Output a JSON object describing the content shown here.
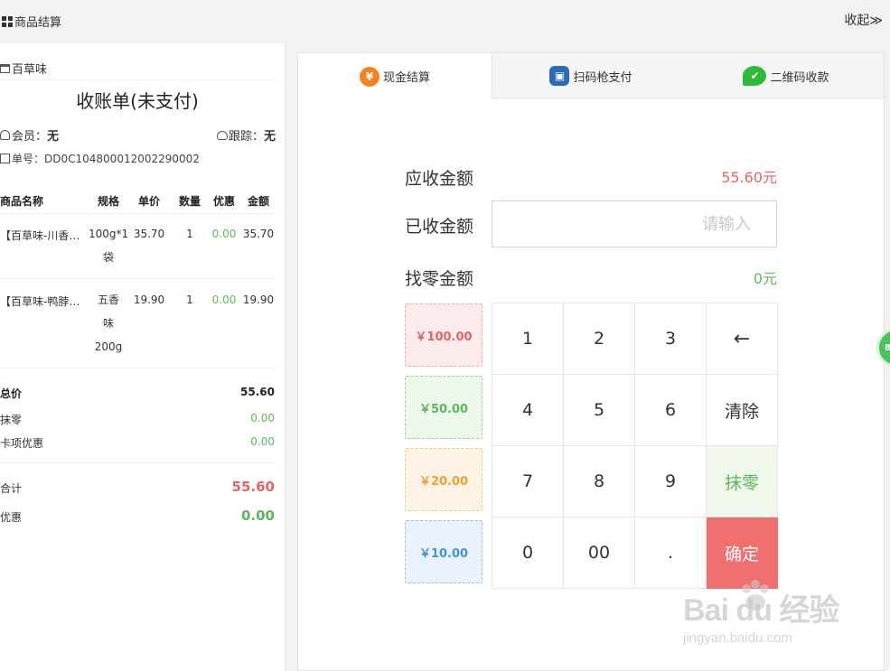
{
  "topbar": {
    "title": "商品结算",
    "collapse": "收起≫"
  },
  "receipt": {
    "shop": "百草味",
    "title": "收账单(未支付)",
    "member_label": "会员：",
    "member_value": "无",
    "track_label": "跟踪：",
    "track_value": "无",
    "order_label": "单号：",
    "order_no": "DD0C104800012002290002",
    "columns": [
      "商品名称",
      "规格",
      "单价",
      "数量",
      "优惠",
      "金额"
    ],
    "items": [
      {
        "name": "【百草味-川香…",
        "spec": [
          "100g*1",
          "袋"
        ],
        "price": "35.70",
        "qty": "1",
        "discount": "0.00",
        "amount": "35.70"
      },
      {
        "name": "【百草味-鸭脖…",
        "spec": [
          "五香",
          "味",
          "200g"
        ],
        "price": "19.90",
        "qty": "1",
        "discount": "0.00",
        "amount": "19.90"
      }
    ],
    "summary": {
      "total_label": "总价",
      "total": "55.60",
      "wipe_label": "抹零",
      "wipe": "0.00",
      "card_label": "卡项优惠",
      "card": "0.00",
      "sum_label": "合计",
      "sum": "55.60",
      "discount_label": "优惠",
      "discount": "0.00"
    }
  },
  "payment": {
    "tabs": [
      {
        "label": "现金结算",
        "icon": "yen-icon"
      },
      {
        "label": "扫码枪支付",
        "icon": "scan-icon"
      },
      {
        "label": "二维码收款",
        "icon": "wechat-icon"
      }
    ],
    "due_label": "应收金额",
    "due_value": "55.60元",
    "paid_label": "已收金额",
    "paid_placeholder": "请输入",
    "change_label": "找零金额",
    "change_value": "0元",
    "quick_amounts": [
      "￥100.00",
      "￥50.00",
      "￥20.00",
      "￥10.00"
    ],
    "keys": [
      "1",
      "2",
      "3",
      "←",
      "4",
      "5",
      "6",
      "清除",
      "7",
      "8",
      "9",
      "抹零",
      "0",
      "00",
      ".",
      "确定"
    ]
  },
  "float_ball": "80",
  "watermark": {
    "brand": "Bai du 经验",
    "sub": "jingyan.baidu.com"
  },
  "colors": {
    "red": "#e96363",
    "green": "#5cb85c",
    "orange": "#f0a030",
    "blue": "#3d95dc",
    "confirm": "#f06f6f"
  }
}
